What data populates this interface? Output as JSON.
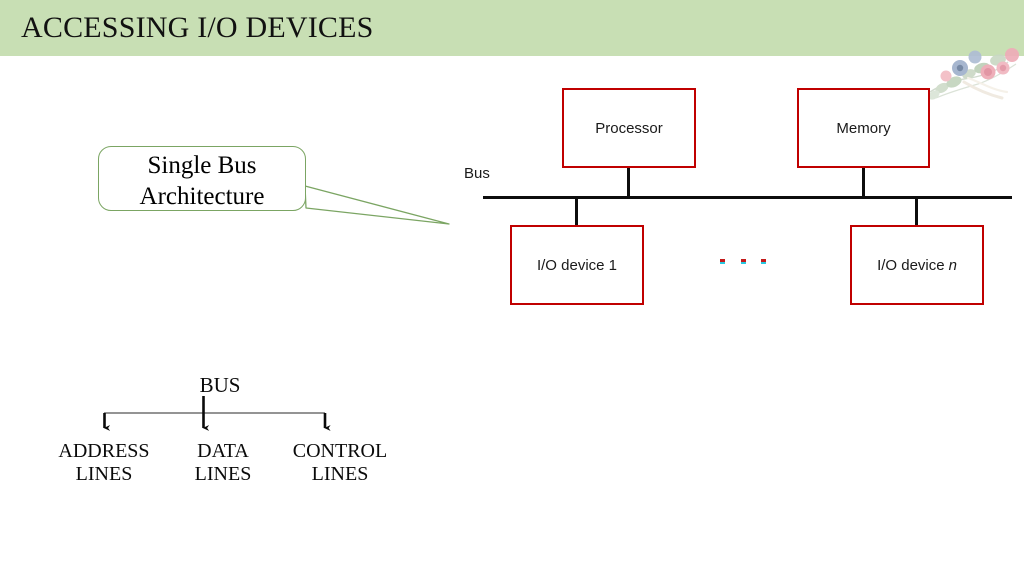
{
  "slide": {
    "header": {
      "title": "ACCESSING I/O DEVICES",
      "band_color": "#C8DFB4"
    },
    "decoration": {
      "name": "floral-bouquet-image"
    }
  },
  "callout": {
    "line1": "Single Bus",
    "line2": "Architecture",
    "text": "Single Bus Architecture",
    "border_color": "#7BA563"
  },
  "bus_diagram": {
    "bus_label": "Bus",
    "bus_line_color": "#0D0D0D",
    "box_border_color": "#C00000",
    "boxes": [
      {
        "id": "processor",
        "label": "Processor"
      },
      {
        "id": "memory",
        "label": "Memory"
      },
      {
        "id": "iodevice1",
        "label": "I/O device 1"
      },
      {
        "id": "iodevicen",
        "label": "I/O device",
        "italic_suffix": "n"
      }
    ],
    "ellipsis": {
      "name": "ellipsis-dots",
      "count": 3,
      "colors": [
        "#C31A1A",
        "#29C8E0"
      ]
    }
  },
  "bus_tree": {
    "root": "BUS",
    "leaves": [
      {
        "id": "address",
        "label": "ADDRESS\nLINES"
      },
      {
        "id": "data",
        "label": "DATA\nLINES"
      },
      {
        "id": "control",
        "label": "CONTROL\nLINES"
      }
    ]
  }
}
